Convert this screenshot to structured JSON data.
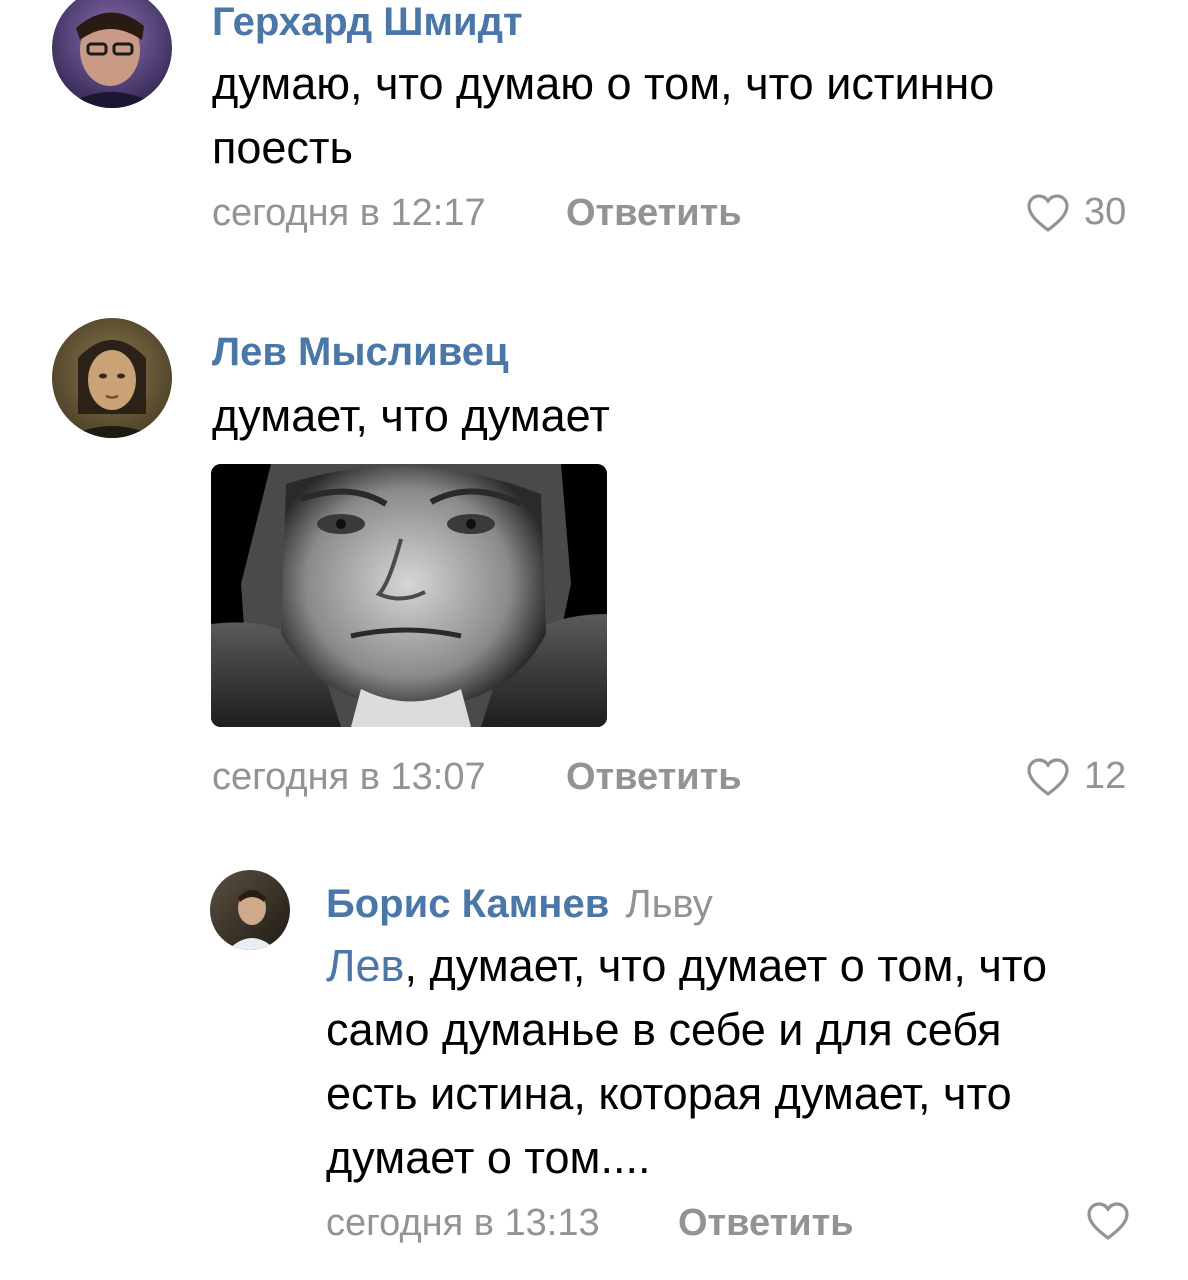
{
  "comments": [
    {
      "author": "Герхард Шмидт",
      "lines": [
        "думаю, что думаю о том, что истинно",
        "поесть"
      ],
      "time": "сегодня в 12:17",
      "reply_label": "Ответить",
      "likes": "30"
    },
    {
      "author": "Лев Мысливец",
      "lines": [
        "думает, что думает"
      ],
      "time": "сегодня в 13:07",
      "reply_label": "Ответить",
      "likes": "12"
    },
    {
      "author": "Борис Камнев",
      "reply_to": "Льву",
      "mention": "Лев",
      "first_line_rest": ", думает, что думает о том, что",
      "lines": [
        "само думанье в себе и для себя",
        "есть истина, которая думает, что",
        "думает о том...."
      ],
      "time": "сегодня в 13:13",
      "reply_label": "Ответить"
    }
  ],
  "icons": {
    "like": "heart-outline-icon"
  },
  "colors": {
    "author": "#4a76a8",
    "meta": "#939393",
    "text": "#000000"
  }
}
